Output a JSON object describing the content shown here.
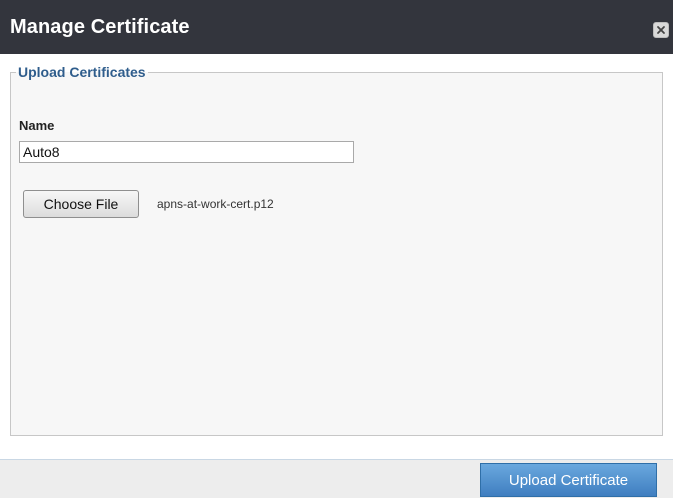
{
  "dialog": {
    "title": "Manage Certificate",
    "close_icon": "close-icon"
  },
  "upload_section": {
    "legend": "Upload Certificates",
    "name_label": "Name",
    "name_value": "Auto8",
    "choose_file_label": "Choose File",
    "file_name": "apns-at-work-cert.p12"
  },
  "footer": {
    "upload_button_label": "Upload Certificate"
  },
  "colors": {
    "titlebar": "#33353d",
    "legend_text": "#2f5d8c",
    "primary_button": "#4a8ad0"
  }
}
